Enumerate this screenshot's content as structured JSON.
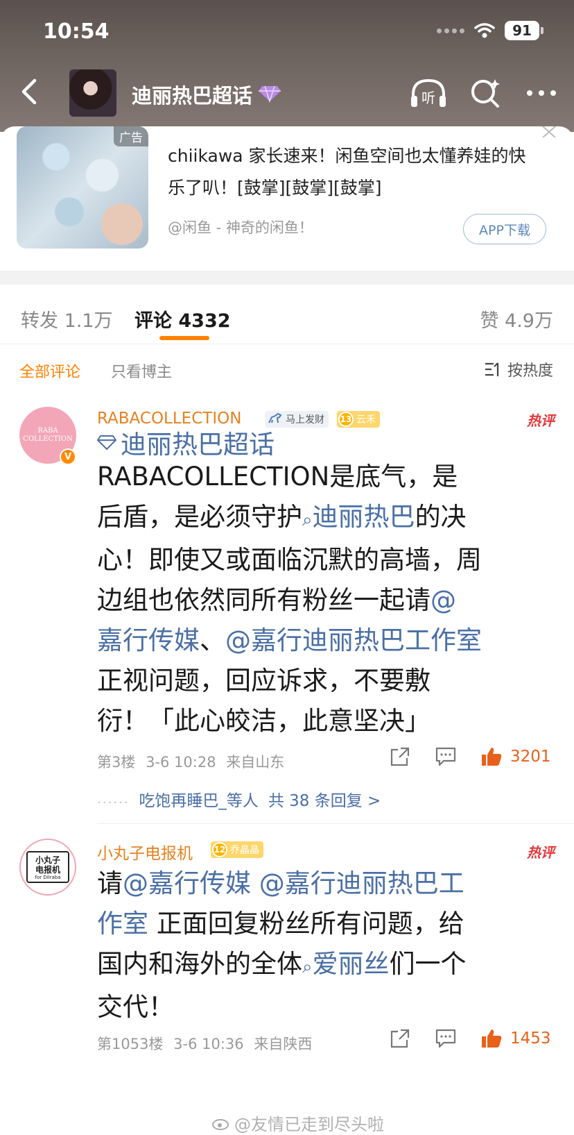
{
  "status_bar": {
    "time": "10:54",
    "battery": "91"
  },
  "nav": {
    "title": "迪丽热巴超话",
    "listen_label": "听",
    "accent": "#ff8200"
  },
  "ad": {
    "tag": "广告",
    "text": "chiikawa 家长速来！闲鱼空间也太懂养娃的快乐了叭！[鼓掌][鼓掌][鼓掌]",
    "source": "@闲鱼 - 神奇的闲鱼！",
    "button": "APP下载"
  },
  "tabs": [
    {
      "label": "转发 1.1万"
    },
    {
      "label": "评论 4332"
    },
    {
      "label": "赞 4.9万"
    }
  ],
  "filter": {
    "all": "全部评论",
    "author_only": "只看博主",
    "sort": "按热度"
  },
  "comments": [
    {
      "name": "RABACOLLECTION",
      "avatar_text": [
        "RABA",
        "COLLECTION"
      ],
      "badge1": "马上发财",
      "level": "13",
      "badge2": "云禾",
      "hot": "热评",
      "topic": "迪丽热巴超话",
      "body": {
        "line1": "RABACOLLECTION是底气，是",
        "line2a": "后盾，是必须守护",
        "line2link": "迪丽热巴",
        "line2b": "的决",
        "line3": "心！即使又或面临沉默的高墙，周",
        "line4a": "边组也依然同所有粉丝一起请",
        "line4link": "@",
        "line5link1": "嘉行传媒",
        "line5sep": "、",
        "line5link2": "@嘉行迪丽热巴工作室",
        "line6": "正视问题，回应诉求，不要敷",
        "line7": "衍！「此心皎洁，此意坚决」"
      },
      "floor": "第3楼",
      "time": "3-6 10:28",
      "location": "来自山东",
      "likes": "3201",
      "reply_summary": "吃饱再睡巴_等人",
      "reply_count": "共 38 条回复 >"
    },
    {
      "name": "小丸子电报机",
      "avatar_text": [
        "小丸子",
        "电报机",
        "for Dilraba"
      ],
      "level": "12",
      "badge2": "乔晶晶",
      "hot": "热评",
      "body": {
        "line1a": "请",
        "line1link": "@嘉行传媒 @嘉行迪丽热巴工",
        "line2link": "作室",
        "line2b": " 正面回复粉丝所有问题，给",
        "line3a": "国内和海外的全体",
        "line3link": "爱丽丝",
        "line3b": "们一个",
        "line4": "交代！"
      },
      "floor": "第1053楼",
      "time": "3-6 10:36",
      "location": "来自陕西",
      "likes": "1453"
    }
  ],
  "watermark": "@友情已走到尽头啦"
}
